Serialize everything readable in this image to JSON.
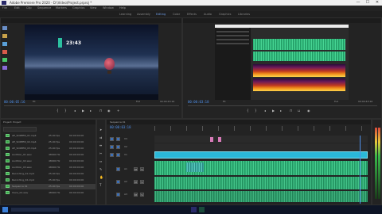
{
  "app": {
    "title": "Adobe Premiere Pro 2020 - D:\\Video\\Project.prproj *"
  },
  "window_buttons": {
    "minimize": "—",
    "maximize": "☐",
    "close": "✕"
  },
  "menu": [
    "File",
    "Edit",
    "Clip",
    "Sequence",
    "Markers",
    "Graphics",
    "View",
    "Window",
    "Help"
  ],
  "workspaces": [
    "Learning",
    "Assembly",
    "Editing",
    "Color",
    "Effects",
    "Audio",
    "Graphics",
    "Libraries"
  ],
  "active_workspace": "Editing",
  "source_monitor": {
    "timecode_left": "00:00:05:16",
    "timecode_right": "00:00:43:16",
    "fit": "Fit",
    "resolution": "Full",
    "desktop_clock": "23:43"
  },
  "program_monitor": {
    "timecode_left": "00:00:03:18",
    "timecode_right": "00:00:43:16",
    "fit": "Fit",
    "resolution": "Full"
  },
  "project_panel": {
    "tab": "Project: Project",
    "items": [
      {
        "name": "AE_SCREEN_01.mp4",
        "rate": "25.00 fps",
        "start": "00:00:00:00"
      },
      {
        "name": "AE_SCREEN_02.mp4",
        "rate": "25.00 fps",
        "start": "00:00:00:00"
      },
      {
        "name": "AE_SCREEN_03.mp4",
        "rate": "25.00 fps",
        "start": "00:00:00:00"
      },
      {
        "name": "Audition_01.wav",
        "rate": "48000 Hz",
        "start": "00:00:00:00"
      },
      {
        "name": "Audition_02.wav",
        "rate": "48000 Hz",
        "start": "00:00:00:00"
      },
      {
        "name": "Audition_03.wav",
        "rate": "48000 Hz",
        "start": "00:00:00:00"
      },
      {
        "name": "Recording_01.mp4",
        "rate": "25.00 fps",
        "start": "00:00:00:00"
      },
      {
        "name": "Recording_02.mp4",
        "rate": "25.00 fps",
        "start": "00:00:00:00"
      },
      {
        "name": "Sequence 01",
        "rate": "25.00 fps",
        "start": "00:00:00:00"
      },
      {
        "name": "Voice_01.wav",
        "rate": "48000 Hz",
        "start": "00:00:00:00"
      }
    ]
  },
  "timeline": {
    "tab": "Sequence 01",
    "timecode": "00:00:03:18",
    "tracks": [
      "V3",
      "V2",
      "V1",
      "A1",
      "A2",
      "A3"
    ]
  },
  "colors": {
    "accent": "#4f8fe8",
    "clip_video": "#2ab8d8",
    "clip_audio": "#2fb87a",
    "playhead": "#4f8fe8"
  }
}
